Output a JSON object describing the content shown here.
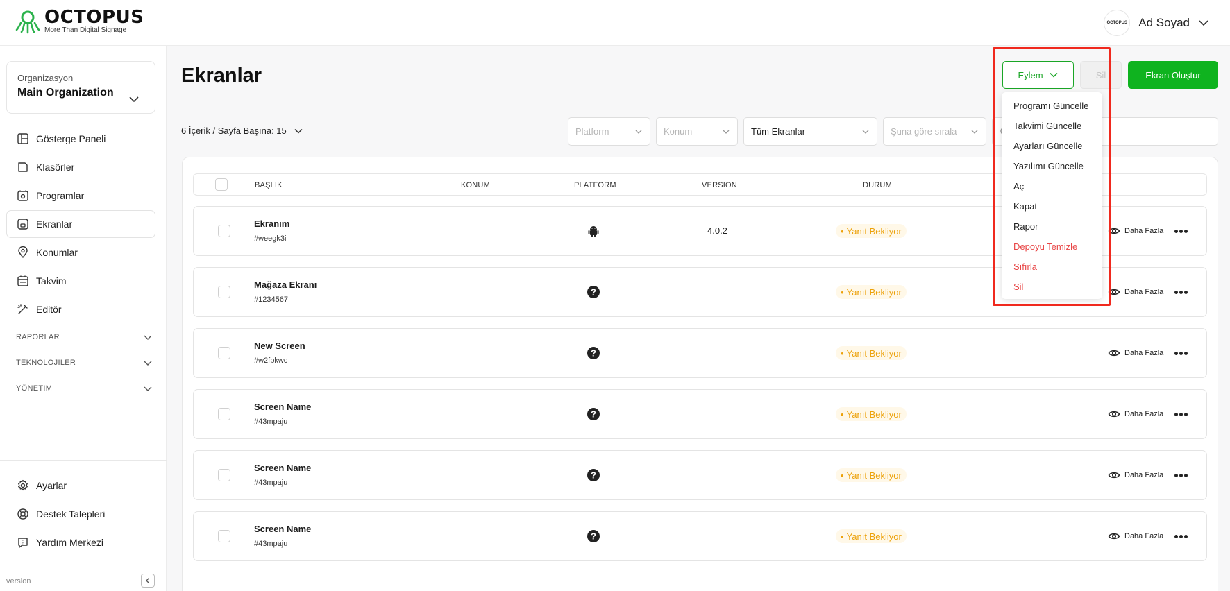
{
  "brand": {
    "name": "OCTOPUS",
    "tagline": "More Than Digital Signage"
  },
  "user": {
    "name": "Ad Soyad",
    "avatar_text": "OCTOPUS"
  },
  "organization": {
    "label": "Organizasyon",
    "name": "Main Organization"
  },
  "sidebar": {
    "items": [
      {
        "label": "Gösterge Paneli",
        "icon": "dashboard-icon"
      },
      {
        "label": "Klasörler",
        "icon": "folder-icon"
      },
      {
        "label": "Programlar",
        "icon": "program-icon"
      },
      {
        "label": "Ekranlar",
        "icon": "screen-icon",
        "active": true
      },
      {
        "label": "Konumlar",
        "icon": "location-icon"
      },
      {
        "label": "Takvim",
        "icon": "calendar-icon"
      },
      {
        "label": "Editör",
        "icon": "editor-icon"
      }
    ],
    "sections": [
      "RAPORLAR",
      "TEKNOLOJILER",
      "YÖNETIM"
    ],
    "bottom_items": [
      {
        "label": "Ayarlar",
        "icon": "gear-icon"
      },
      {
        "label": "Destek Talepleri",
        "icon": "support-icon"
      },
      {
        "label": "Yardım Merkezi",
        "icon": "help-icon"
      }
    ],
    "version_label": "version"
  },
  "page": {
    "title": "Ekranlar",
    "action_label": "Eylem",
    "delete_label": "Sil",
    "create_label": "Ekran Oluştur",
    "count_text": "6 İçerik / Sayfa Başına: 15"
  },
  "filters": {
    "platform": "Platform",
    "location": "Konum",
    "screens": "Tüm Ekranlar",
    "sort": "Şuna göre sırala"
  },
  "table": {
    "headers": {
      "title": "BAŞLIK",
      "location": "KONUM",
      "platform": "PLATFORM",
      "version": "VERSION",
      "status": "DURUM"
    },
    "rows": [
      {
        "title": "Ekranım",
        "id": "#weegk3i",
        "platform": "android",
        "version": "4.0.2",
        "status": "Yanıt Bekliyor",
        "more": "Daha Fazla"
      },
      {
        "title": "Mağaza Ekranı",
        "id": "#1234567",
        "platform": "unknown",
        "version": "",
        "status": "Yanıt Bekliyor",
        "more": "Daha Fazla"
      },
      {
        "title": "New Screen",
        "id": "#w2fpkwc",
        "platform": "unknown",
        "version": "",
        "status": "Yanıt Bekliyor",
        "more": "Daha Fazla"
      },
      {
        "title": "Screen Name",
        "id": "#43mpaju",
        "platform": "unknown",
        "version": "",
        "status": "Yanıt Bekliyor",
        "more": "Daha Fazla"
      },
      {
        "title": "Screen Name",
        "id": "#43mpaju",
        "platform": "unknown",
        "version": "",
        "status": "Yanıt Bekliyor",
        "more": "Daha Fazla"
      },
      {
        "title": "Screen Name",
        "id": "#43mpaju",
        "platform": "unknown",
        "version": "",
        "status": "Yanıt Bekliyor",
        "more": "Daha Fazla"
      }
    ]
  },
  "action_menu": {
    "items": [
      {
        "label": "Programı Güncelle",
        "danger": false
      },
      {
        "label": "Takvimi Güncelle",
        "danger": false
      },
      {
        "label": "Ayarları Güncelle",
        "danger": false
      },
      {
        "label": "Yazılımı Güncelle",
        "danger": false
      },
      {
        "label": "Aç",
        "danger": false
      },
      {
        "label": "Kapat",
        "danger": false
      },
      {
        "label": "Rapor",
        "danger": false
      },
      {
        "label": "Depoyu Temizle",
        "danger": true
      },
      {
        "label": "Sıfırla",
        "danger": true
      },
      {
        "label": "Sil",
        "danger": true
      }
    ]
  },
  "colors": {
    "accent": "#0fb31f",
    "status": "#eca10a",
    "danger": "#e84646",
    "highlight": "#f0291e"
  }
}
